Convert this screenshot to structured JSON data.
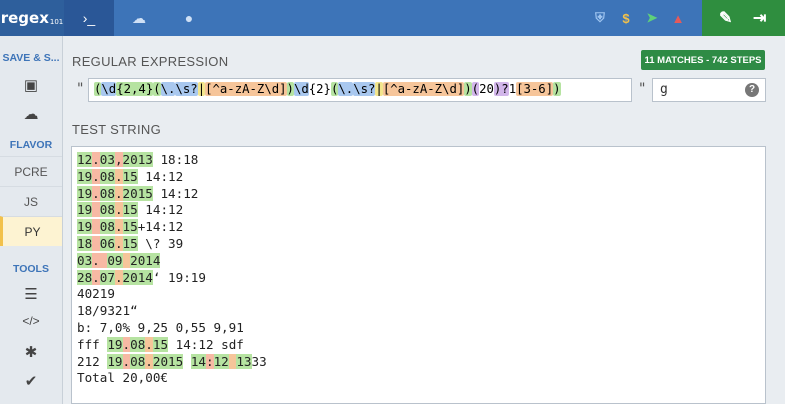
{
  "app": {
    "logo_text": "regex",
    "logo_suffix": "101",
    "nav_tabs": [
      {
        "name": "terminal",
        "icon": "terminal-icon",
        "glyph": "›_",
        "active": true
      },
      {
        "name": "cloud",
        "icon": "cloud-icon",
        "glyph": "☁",
        "active": false
      },
      {
        "name": "chat",
        "icon": "chat-icon",
        "glyph": "●",
        "active": false
      }
    ],
    "top_icons": [
      {
        "icon": "shield-icon",
        "glyph": "⛨",
        "color": "#9ec4f0"
      },
      {
        "icon": "dollar-icon",
        "glyph": "$",
        "color": "#f2c14b"
      },
      {
        "icon": "paper-plane-icon",
        "glyph": "➤",
        "color": "#5fd17a"
      },
      {
        "icon": "warning-icon",
        "glyph": "▲",
        "color": "#e55a5a"
      }
    ],
    "right_icons": [
      {
        "icon": "wrench-icon",
        "glyph": "✎"
      },
      {
        "icon": "sign-in-icon",
        "glyph": "⇥"
      }
    ]
  },
  "sidebar": {
    "save_heading": "SAVE & S...",
    "flavor_heading": "FLAVOR",
    "flavors": [
      {
        "label": "PCRE",
        "active": false
      },
      {
        "label": "JS",
        "active": false
      },
      {
        "label": "PY",
        "active": true
      }
    ],
    "tools_heading": "TOOLS",
    "save_icons": [
      {
        "icon": "save-icon",
        "glyph": "▣"
      },
      {
        "icon": "cloud-upload-icon",
        "glyph": "☁"
      }
    ],
    "tool_icons": [
      {
        "icon": "list-icon",
        "glyph": "☰"
      },
      {
        "icon": "code-icon",
        "glyph": "</>"
      },
      {
        "icon": "bug-icon",
        "glyph": "✱"
      },
      {
        "icon": "check-icon",
        "glyph": "✔"
      }
    ]
  },
  "regex_section": {
    "label": "REGULAR EXPRESSION",
    "match_badge": "11 MATCHES - 742 STEPS",
    "open_quote": "\"",
    "close_quote": "\"",
    "tokens": [
      {
        "text": "(",
        "cls": "c-grp"
      },
      {
        "text": "\\d",
        "cls": "c-cls"
      },
      {
        "text": "{2,4}",
        "cls": "c-grp"
      },
      {
        "text": "(",
        "cls": "c-grp"
      },
      {
        "text": "\\.",
        "cls": "c-cls"
      },
      {
        "text": "\\s?",
        "cls": "c-cls"
      },
      {
        "text": "|",
        "cls": "c-alt"
      },
      {
        "text": "[^a-zA-Z\\d]",
        "cls": "c-set"
      },
      {
        "text": ")",
        "cls": "c-grp"
      },
      {
        "text": "\\d",
        "cls": "c-cls"
      },
      {
        "text": "{2}",
        "cls": "c-plain"
      },
      {
        "text": "(",
        "cls": "c-grp"
      },
      {
        "text": "\\.",
        "cls": "c-cls"
      },
      {
        "text": "\\s?",
        "cls": "c-cls"
      },
      {
        "text": "|",
        "cls": "c-alt"
      },
      {
        "text": "[^a-zA-Z\\d]",
        "cls": "c-set"
      },
      {
        "text": ")",
        "cls": "c-grp"
      },
      {
        "text": "(",
        "cls": "c-quant"
      },
      {
        "text": "20",
        "cls": "c-plain"
      },
      {
        "text": ")?",
        "cls": "c-quant"
      },
      {
        "text": "1",
        "cls": "c-plain"
      },
      {
        "text": "[3-6]",
        "cls": "c-set"
      },
      {
        "text": ")",
        "cls": "c-grp"
      }
    ],
    "flags": "g",
    "help_glyph": "?"
  },
  "test_section": {
    "label": "TEST STRING",
    "lines": [
      [
        {
          "t": "12",
          "c": "seg-g"
        },
        {
          "t": ".",
          "c": "seg-r"
        },
        {
          "t": "03",
          "c": "seg-g"
        },
        {
          "t": ",",
          "c": "seg-r"
        },
        {
          "t": "2013",
          "c": "seg-g"
        },
        {
          "t": " 18:18",
          "c": ""
        }
      ],
      [
        {
          "t": "19",
          "c": "seg-g"
        },
        {
          "t": ".",
          "c": "seg-r"
        },
        {
          "t": "08",
          "c": "seg-g"
        },
        {
          "t": ".",
          "c": "seg-o"
        },
        {
          "t": "15",
          "c": "seg-g"
        },
        {
          "t": " 14:12",
          "c": ""
        }
      ],
      [
        {
          "t": "19",
          "c": "seg-g"
        },
        {
          "t": ".",
          "c": "seg-r"
        },
        {
          "t": "08",
          "c": "seg-g"
        },
        {
          "t": ".",
          "c": "seg-o"
        },
        {
          "t": "2015",
          "c": "seg-g"
        },
        {
          "t": " 14:12",
          "c": ""
        }
      ],
      [
        {
          "t": "19",
          "c": "seg-g"
        },
        {
          "t": " ",
          "c": "seg-r"
        },
        {
          "t": "08",
          "c": "seg-g"
        },
        {
          "t": ".",
          "c": "seg-o"
        },
        {
          "t": "15",
          "c": "seg-g"
        },
        {
          "t": " 14:12",
          "c": ""
        }
      ],
      [
        {
          "t": "19",
          "c": "seg-g"
        },
        {
          "t": " ",
          "c": "seg-r"
        },
        {
          "t": "08",
          "c": "seg-g"
        },
        {
          "t": ".",
          "c": "seg-o"
        },
        {
          "t": "15",
          "c": "seg-g"
        },
        {
          "t": "+14:12",
          "c": ""
        }
      ],
      [
        {
          "t": "18",
          "c": "seg-g"
        },
        {
          "t": " ",
          "c": "seg-r"
        },
        {
          "t": "06",
          "c": "seg-g"
        },
        {
          "t": ".",
          "c": "seg-o"
        },
        {
          "t": "15",
          "c": "seg-g"
        },
        {
          "t": " \\? 39",
          "c": ""
        }
      ],
      [
        {
          "t": "03",
          "c": "seg-g"
        },
        {
          "t": ". ",
          "c": "seg-r"
        },
        {
          "t": "09",
          "c": "seg-g"
        },
        {
          "t": " ",
          "c": "seg-o"
        },
        {
          "t": "2014",
          "c": "seg-g"
        }
      ],
      [
        {
          "t": "28",
          "c": "seg-g"
        },
        {
          "t": ".",
          "c": "seg-r"
        },
        {
          "t": "07",
          "c": "seg-g"
        },
        {
          "t": ".",
          "c": "seg-o"
        },
        {
          "t": "2014",
          "c": "seg-g"
        },
        {
          "t": "‘ 19:19",
          "c": ""
        }
      ],
      [
        {
          "t": "40219",
          "c": ""
        }
      ],
      [
        {
          "t": "18/9321“",
          "c": ""
        }
      ],
      [
        {
          "t": "b: 7,0% 9,25 0,55 9,91",
          "c": ""
        }
      ],
      [
        {
          "t": "fff ",
          "c": ""
        },
        {
          "t": "19",
          "c": "seg-g"
        },
        {
          "t": ".",
          "c": "seg-r"
        },
        {
          "t": "08",
          "c": "seg-g"
        },
        {
          "t": ".",
          "c": "seg-o"
        },
        {
          "t": "15",
          "c": "seg-g"
        },
        {
          "t": " 14:12 sdf",
          "c": ""
        }
      ],
      [
        {
          "t": "212 ",
          "c": ""
        },
        {
          "t": "19",
          "c": "seg-g"
        },
        {
          "t": ".",
          "c": "seg-r"
        },
        {
          "t": "08",
          "c": "seg-g"
        },
        {
          "t": ".",
          "c": "seg-o"
        },
        {
          "t": "2015",
          "c": "seg-g"
        },
        {
          "t": " ",
          "c": ""
        },
        {
          "t": "14",
          "c": "seg-g"
        },
        {
          "t": ":",
          "c": "seg-r"
        },
        {
          "t": "12",
          "c": "seg-g"
        },
        {
          "t": " ",
          "c": "seg-o"
        },
        {
          "t": "13",
          "c": "seg-g"
        },
        {
          "t": "33",
          "c": ""
        }
      ],
      [
        {
          "t": "Total 20,00€",
          "c": ""
        }
      ]
    ]
  }
}
